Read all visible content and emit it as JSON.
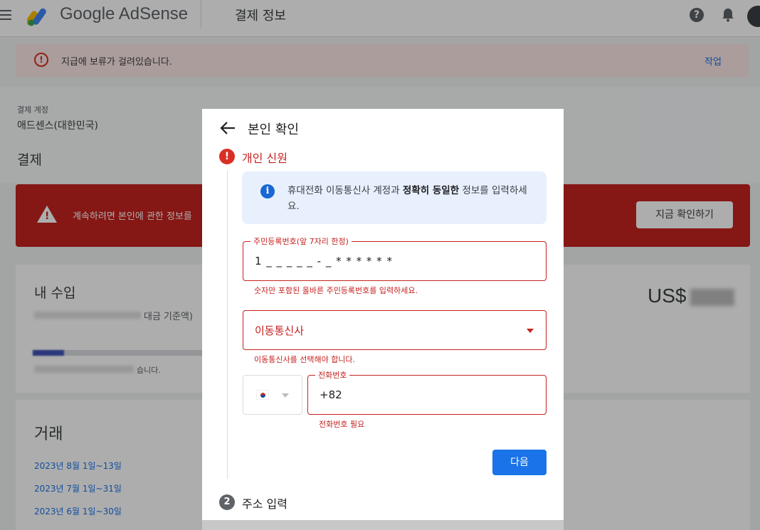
{
  "header": {
    "brand": "Google AdSense",
    "page_title": "결제 정보",
    "help_glyph": "?",
    "icons": [
      "menu-icon",
      "adsense-logo-icon",
      "help-icon",
      "bell-icon",
      "avatar"
    ]
  },
  "warning_banner": {
    "glyph": "!",
    "text": "지급에 보류가 걸려있습니다.",
    "action": "작업"
  },
  "payments_account": {
    "label": "결제 계정",
    "value": "애드센스(대한민국)"
  },
  "payments_heading": "결제",
  "alert_banner": {
    "glyph": "!",
    "text": "계속하려면 본인에 관한 정보를",
    "button": "지금 확인하기"
  },
  "income": {
    "title": "내 수입",
    "subtitle": "대금 기준액)",
    "amount_prefix": "US$",
    "footnote": "습니다."
  },
  "transactions": {
    "title": "거래",
    "links": [
      "2023년 8월 1일~13일",
      "2023년 7월 1일~31일",
      "2023년 6월 1일~30일"
    ]
  },
  "dialog": {
    "title": "본인 확인",
    "step1": {
      "icon_glyph": "!",
      "label": "개인 신원"
    },
    "info": {
      "icon_glyph": "i",
      "text_before": "휴대전화 이동통신사 계정과 ",
      "text_bold": "정확히 동일한",
      "text_after": " 정보를 입력하세요."
    },
    "rrn_field": {
      "label": "주민등록번호(앞 7자리 한정)",
      "value": "1 _ _ _ _ _ - _ * * * * * *",
      "error": "숫자만 포함된 올바른 주민등록번호를 입력하세요."
    },
    "carrier_field": {
      "value": "이동통신사",
      "error": "이동통신사를 선택해야 합니다."
    },
    "phone_field": {
      "label": "전화번호",
      "value": "+82",
      "error": "전화번호 필요"
    },
    "next_button": "다음",
    "step2": {
      "icon_glyph": "2",
      "label": "주소 입력"
    }
  },
  "colors": {
    "error_red": "#c5221f",
    "primary_blue": "#1a73e8",
    "info_bg": "#e8f0fe"
  }
}
